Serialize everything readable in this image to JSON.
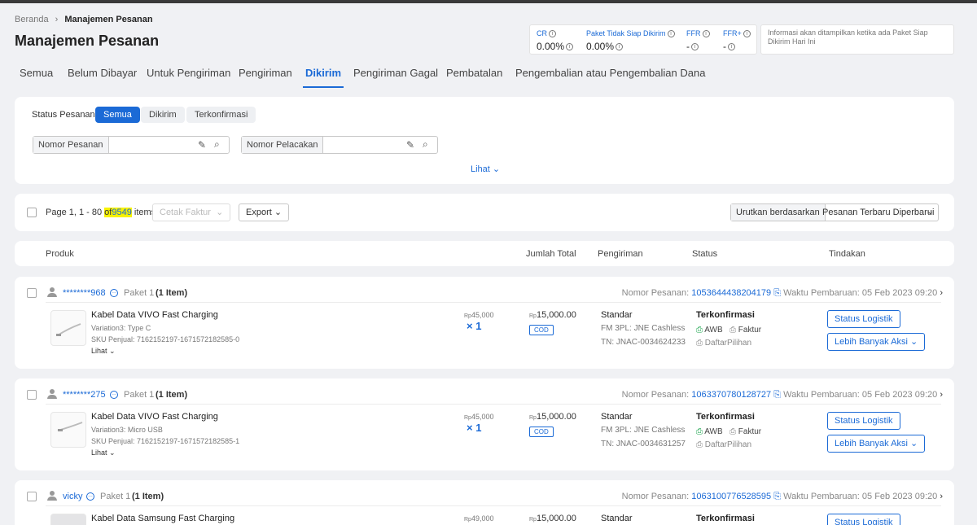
{
  "breadcrumb": {
    "home": "Beranda",
    "sep": "›",
    "current": "Manajemen Pesanan"
  },
  "page_title": "Manajemen Pesanan",
  "metrics": [
    {
      "label": "CR",
      "value": "0.00%"
    },
    {
      "label": "Paket Tidak Siap Dikirim",
      "value": "0.00%"
    },
    {
      "label": "FFR",
      "value": "-"
    },
    {
      "label": "FFR+",
      "value": "-"
    }
  ],
  "info_text": "Informasi akan ditampilkan ketika ada Paket Siap Dikirim Hari Ini",
  "tabs": [
    {
      "label": "Semua"
    },
    {
      "label": "Belum Dibayar"
    },
    {
      "label": "Untuk Pengiriman"
    },
    {
      "label": "Pengiriman"
    },
    {
      "label": "Dikirim",
      "active": true
    },
    {
      "label": "Pengiriman Gagal"
    },
    {
      "label": "Pembatalan"
    },
    {
      "label": "Pengembalian atau Pengembalian Dana"
    }
  ],
  "filters": {
    "status_label": "Status Pesanan:",
    "status_options": [
      "Semua",
      "Dikirim",
      "Terkonfirmasi"
    ],
    "order_number_label": "Nomor Pesanan",
    "order_number_value": "",
    "tracking_label": "Nomor Pelacakan",
    "tracking_value": "",
    "more_label": "Lihat"
  },
  "toolbar": {
    "page_text": "Page 1, 1 - 80",
    "of_text": "of",
    "total": "9549",
    "items_text": "items",
    "print_invoice": "Cetak Faktur",
    "export": "Export",
    "sort_label": "Urutkan berdasarkan",
    "sort_value": "Pesanan Terbaru Diperbarui"
  },
  "columns": {
    "product": "Produk",
    "total": "Jumlah Total",
    "shipping": "Pengiriman",
    "status": "Status",
    "action": "Tindakan"
  },
  "labels": {
    "order_no": "Nomor Pesanan:",
    "updated": "Waktu Pembaruan:",
    "currency": "Rp",
    "awb": "AWB",
    "invoice": "Faktur",
    "picklist": "DaftarPilihan",
    "logistics_btn": "Status Logistik",
    "more_actions_btn": "Lebih Banyak Aksi",
    "see": "Lihat"
  },
  "orders": [
    {
      "buyer": "********968",
      "package": "Paket 1",
      "count": "(1 Item)",
      "order_no": "1053644438204179",
      "updated": "05 Feb 2023 09:20",
      "product": "Kabel Data VIVO Fast Charging",
      "variation": "Variation3: Type C",
      "sku": "SKU Penjual: 7162152197-1671572182585-0",
      "unit_price": "45,000",
      "qty": "× 1",
      "total": "15,000.00",
      "payment": "COD",
      "ship_type": "Standar",
      "courier": "FM 3PL: JNE Cashless",
      "tracking": "TN: JNAC-0034624233",
      "status": "Terkonfirmasi"
    },
    {
      "buyer": "********275",
      "package": "Paket 1",
      "count": "(1 Item)",
      "order_no": "1063370780128727",
      "updated": "05 Feb 2023 09:20",
      "product": "Kabel Data VIVO Fast Charging",
      "variation": "Variation3: Micro USB",
      "sku": "SKU Penjual: 7162152197-1671572182585-1",
      "unit_price": "45,000",
      "qty": "× 1",
      "total": "15,000.00",
      "payment": "COD",
      "ship_type": "Standar",
      "courier": "FM 3PL: JNE Cashless",
      "tracking": "TN: JNAC-0034631257",
      "status": "Terkonfirmasi"
    },
    {
      "buyer": "vicky",
      "package": "Paket 1",
      "count": "(1 Item)",
      "order_no": "1063100776528595",
      "updated": "05 Feb 2023 09:20",
      "product": "Kabel Data Samsung Fast Charging",
      "unit_price": "49,000",
      "total": "15,000.00",
      "ship_type": "Standar",
      "status": "Terkonfirmasi"
    }
  ]
}
